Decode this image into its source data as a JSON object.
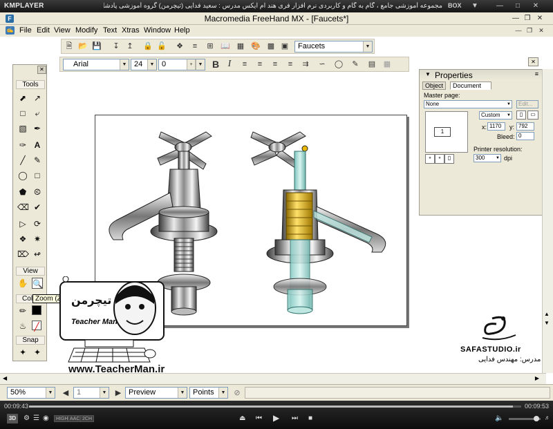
{
  "player": {
    "logo": "KMPLAYER",
    "title": "مجموعه آموزشی جامع ، گام به گام و کاربردی نرم افزار فری هند ام ایکس   مدرس : سعید فدایی (تیچرمن) گروه آموزشی پادشاه گرافیست ها",
    "box_label": "BOX",
    "time_elapsed": "00:09:43",
    "time_total": "00:09:53",
    "progress": 0.983,
    "tags": [
      "HIGH",
      "AAC",
      "2CH"
    ],
    "mode_badge": "3D"
  },
  "window": {
    "title": "Macromedia FreeHand MX - [Faucets*]"
  },
  "menu": [
    "File",
    "Edit",
    "View",
    "Modify",
    "Text",
    "Xtras",
    "Window",
    "Help"
  ],
  "toolbar": {
    "document_select": "Faucets",
    "font_family": "Arial",
    "font_size": "24",
    "leading": "0",
    "bold_label": "B",
    "italic_label": "I"
  },
  "tools_panel": {
    "title": "Tools",
    "view_section": "View",
    "color_section": "Color",
    "snap_section": "Snap",
    "tooltip": "Zoom (Z)"
  },
  "properties": {
    "title": "Properties",
    "tabs": [
      "Object",
      "Document"
    ],
    "master_page_label": "Master page:",
    "master_page_value": "None",
    "edit_button": "Edit...",
    "page_thumb_number": "1",
    "page_size": "Custom",
    "x_label": "x:",
    "x_value": "1170",
    "y_label": "y:",
    "y_value": "792",
    "bleed_label": "Bleed:",
    "bleed_value": "0",
    "resolution_label": "Printer resolution:",
    "resolution_value": "300",
    "resolution_unit": "dpi"
  },
  "status": {
    "zoom": "50%",
    "page_number": "1",
    "view_mode": "Preview",
    "units": "Points"
  },
  "overlay": {
    "teacher_brand": "Teacher Man",
    "teacher_url": "www.TeacherMan.ir",
    "safa_brand": "SAFASTUDIO.ir",
    "safa_instructor": "مدرس: مهندس فدایی"
  }
}
